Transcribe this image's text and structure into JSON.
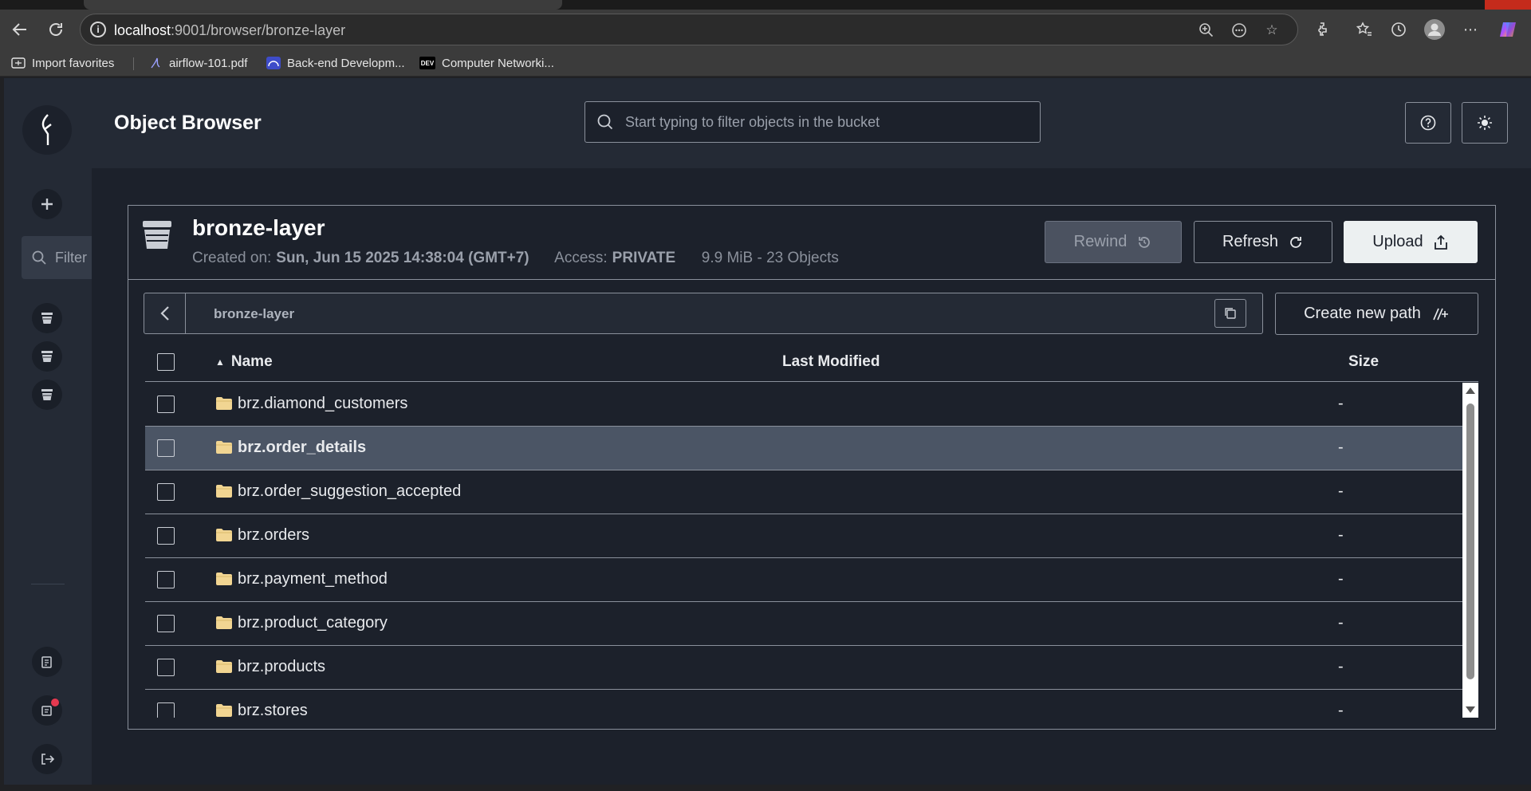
{
  "browser": {
    "url_host": "localhost",
    "url_rest": ":9001/browser/bronze-layer",
    "bookmarks": [
      {
        "label": "Import favorites",
        "icon": "folder-icon"
      },
      {
        "label": "airflow-101.pdf",
        "icon": "pdf-icon"
      },
      {
        "label": "Back-end Developm...",
        "icon": "site-icon"
      },
      {
        "label": "Computer Networki...",
        "icon": "dev-icon"
      }
    ],
    "dev_badge": "DEV"
  },
  "sidebar": {
    "filter_placeholder": "Filter"
  },
  "header": {
    "title": "Object Browser",
    "search_placeholder": "Start typing to filter objects in the bucket"
  },
  "bucket": {
    "name": "bronze-layer",
    "created_label": "Created on:",
    "created_value": "Sun, Jun 15 2025 14:38:04 (GMT+7)",
    "access_label": "Access:",
    "access_value": "PRIVATE",
    "usage": "9.9 MiB - 23 Objects",
    "rewind_label": "Rewind",
    "refresh_label": "Refresh",
    "upload_label": "Upload"
  },
  "path": {
    "current": "bronze-layer",
    "create_new_path_label": "Create new path"
  },
  "table": {
    "columns": {
      "name": "Name",
      "last_modified": "Last Modified",
      "size": "Size"
    },
    "rows": [
      {
        "name": "brz.diamond_customers",
        "last_modified": "",
        "size": "-",
        "selected": false
      },
      {
        "name": "brz.order_details",
        "last_modified": "",
        "size": "-",
        "selected": true
      },
      {
        "name": "brz.order_suggestion_accepted",
        "last_modified": "",
        "size": "-",
        "selected": false
      },
      {
        "name": "brz.orders",
        "last_modified": "",
        "size": "-",
        "selected": false
      },
      {
        "name": "brz.payment_method",
        "last_modified": "",
        "size": "-",
        "selected": false
      },
      {
        "name": "brz.product_category",
        "last_modified": "",
        "size": "-",
        "selected": false
      },
      {
        "name": "brz.products",
        "last_modified": "",
        "size": "-",
        "selected": false
      },
      {
        "name": "brz.stores",
        "last_modified": "",
        "size": "-",
        "selected": false
      }
    ]
  },
  "colors": {
    "app_bg": "#1c212b",
    "panel_bg": "#242a35",
    "selected_row": "#4b5565",
    "folder": "#f1d592",
    "notification": "#e53950"
  }
}
